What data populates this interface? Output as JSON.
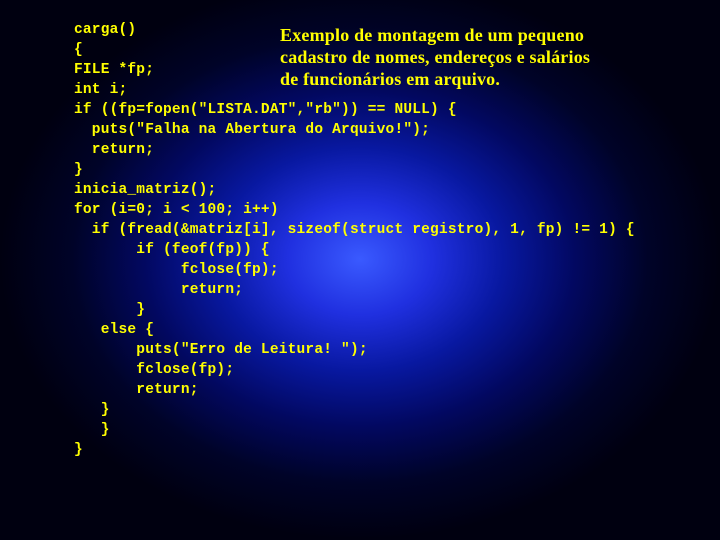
{
  "caption": {
    "line1": "Exemplo de montagem de um pequeno",
    "line2": " cadastro de nomes, endereços e salários",
    "line3": "de funcionários em arquivo."
  },
  "code": {
    "l01": "carga()",
    "l02": "{",
    "l03": "FILE *fp;",
    "l04": "int i;",
    "l05": "if ((fp=fopen(\"LISTA.DAT\",\"rb\")) == NULL) {",
    "l06": "  puts(\"Falha na Abertura do Arquivo!\");",
    "l07": "  return;",
    "l08": "}",
    "l09": "inicia_matriz();",
    "l10": "for (i=0; i < 100; i++)",
    "l11": "  if (fread(&matriz[i], sizeof(struct registro), 1, fp) != 1) {",
    "l12": "       if (feof(fp)) {",
    "l13": "            fclose(fp);",
    "l14": "            return;",
    "l15": "       }",
    "l16": "   else {",
    "l17": "       puts(\"Erro de Leitura! \");",
    "l18": "       fclose(fp);",
    "l19": "       return;",
    "l20": "   }",
    "l21": "   }",
    "l22": "}"
  }
}
